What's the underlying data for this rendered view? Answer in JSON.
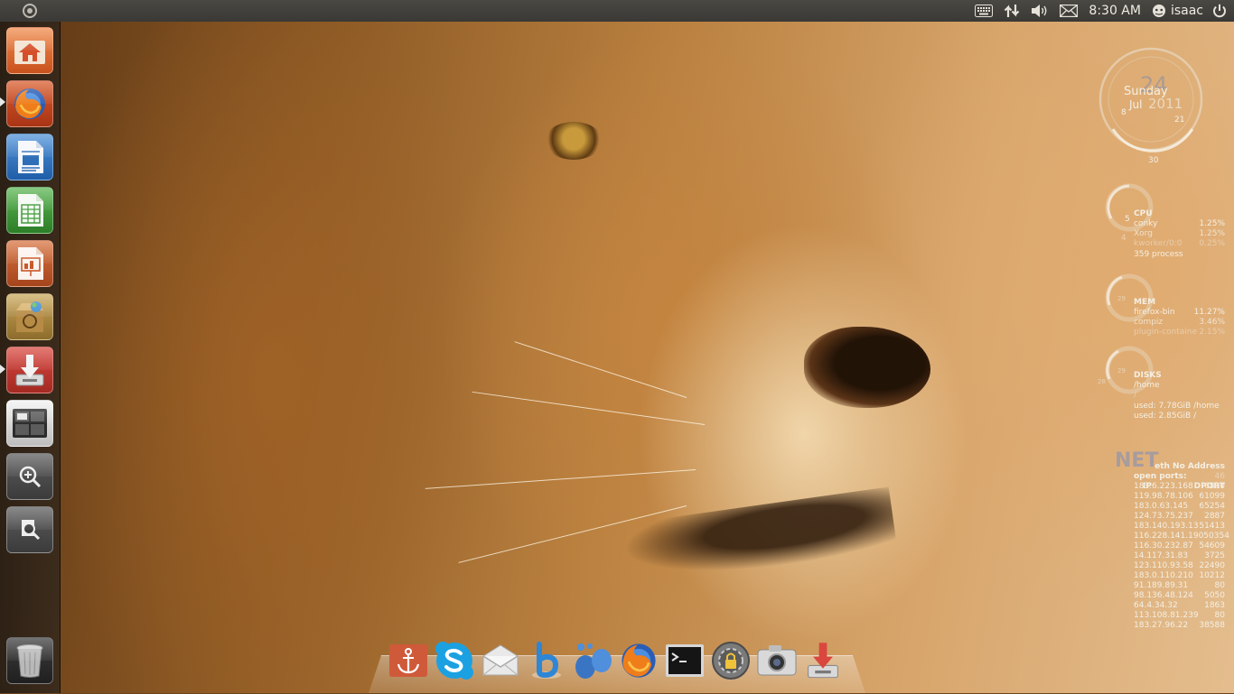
{
  "top_panel": {
    "clock": "8:30 AM",
    "username": "isaac",
    "indicators": [
      "keyboard-icon",
      "network-icon",
      "volume-icon",
      "mail-icon",
      "user-icon",
      "power-icon"
    ]
  },
  "launcher": {
    "items": [
      {
        "name": "home-folder",
        "icon": "home-folder-icon"
      },
      {
        "name": "firefox",
        "icon": "firefox-icon",
        "running": true
      },
      {
        "name": "libreoffice-writer",
        "icon": "writer-icon"
      },
      {
        "name": "libreoffice-calc",
        "icon": "calc-icon"
      },
      {
        "name": "libreoffice-impress",
        "icon": "impress-icon"
      },
      {
        "name": "ubuntu-software-center",
        "icon": "software-center-icon"
      },
      {
        "name": "update-manager",
        "icon": "update-manager-icon",
        "running": true
      },
      {
        "name": "workspace-switcher",
        "icon": "workspace-switcher-icon"
      },
      {
        "name": "zoom-in",
        "icon": "zoom-in-icon"
      },
      {
        "name": "zoom-search",
        "icon": "magnifier-icon"
      },
      {
        "name": "trash",
        "icon": "trash-icon"
      }
    ]
  },
  "conky": {
    "date": {
      "weekday": "Sunday",
      "day_big": "24",
      "month": "Jul",
      "year": "2011",
      "dial_labels": [
        "8",
        "21",
        "30"
      ]
    },
    "cpu": {
      "title": "CPU",
      "dial_labels": [
        "5",
        "4"
      ],
      "processes": [
        {
          "name": "conky",
          "value": "1.25%"
        },
        {
          "name": "Xorg",
          "value": "1.25%"
        },
        {
          "name": "kworker/0:0",
          "value": "0.25%"
        }
      ],
      "process_count": "359 process"
    },
    "mem": {
      "title": "MEM",
      "dial_label": "29",
      "processes": [
        {
          "name": "firefox-bin",
          "value": "11.27%"
        },
        {
          "name": "compiz",
          "value": "3.46%"
        },
        {
          "name": "plugin-containe",
          "value": "2.15%"
        }
      ]
    },
    "disks": {
      "title": "DISKS",
      "dial_labels": [
        "29",
        "28"
      ],
      "mounts": [
        "/home",
        "/"
      ],
      "usage": [
        "used: 7.78GiB /home",
        "used: 2.85GiB /"
      ]
    },
    "net": {
      "big_label": "NET",
      "interface": "eth No Address",
      "open_ports_label": "open ports:",
      "open_ports_count": "46",
      "col_ip": "IP",
      "col_dport": "DPORT",
      "rows": [
        {
          "ip": "183.6.223.168",
          "port": "6890"
        },
        {
          "ip": "119.98.78.106",
          "port": "61099"
        },
        {
          "ip": "183.0.63.145",
          "port": "65254"
        },
        {
          "ip": "124.73.75.237",
          "port": "2887"
        },
        {
          "ip": "183.140.193.13",
          "port": "51413"
        },
        {
          "ip": "116.228.141.190",
          "port": "50354"
        },
        {
          "ip": "116.30.232.87",
          "port": "54609"
        },
        {
          "ip": "14.117.31.83",
          "port": "3725"
        },
        {
          "ip": "123.110.93.58",
          "port": "22490"
        },
        {
          "ip": "183.0.110.210",
          "port": "10212"
        },
        {
          "ip": "91.189.89.31",
          "port": "80"
        },
        {
          "ip": "98.136.48.124",
          "port": "5050"
        },
        {
          "ip": "64.4.34.32",
          "port": "1863"
        },
        {
          "ip": "113.108.81.239",
          "port": "80"
        },
        {
          "ip": "183.27.96.22",
          "port": "38588"
        }
      ]
    }
  },
  "dock": {
    "items": [
      {
        "name": "docky-anchor",
        "icon": "anchor-icon"
      },
      {
        "name": "skype",
        "icon": "skype-icon"
      },
      {
        "name": "mail",
        "icon": "envelope-icon"
      },
      {
        "name": "beatbox",
        "icon": "music-b-icon"
      },
      {
        "name": "empathy",
        "icon": "chat-bubbles-icon"
      },
      {
        "name": "firefox",
        "icon": "firefox-icon"
      },
      {
        "name": "terminal",
        "icon": "terminal-icon"
      },
      {
        "name": "disk-utility",
        "icon": "gear-lock-icon"
      },
      {
        "name": "screenshot",
        "icon": "camera-icon"
      },
      {
        "name": "update-manager",
        "icon": "update-manager-icon"
      }
    ]
  },
  "colors": {
    "panel_bg": "#3a3935",
    "launcher_home": "#e06a2c",
    "writer_blue": "#2f6fb8",
    "calc_green": "#3f9a3a",
    "impress_orange": "#c8582a",
    "update_red": "#c33b32"
  }
}
